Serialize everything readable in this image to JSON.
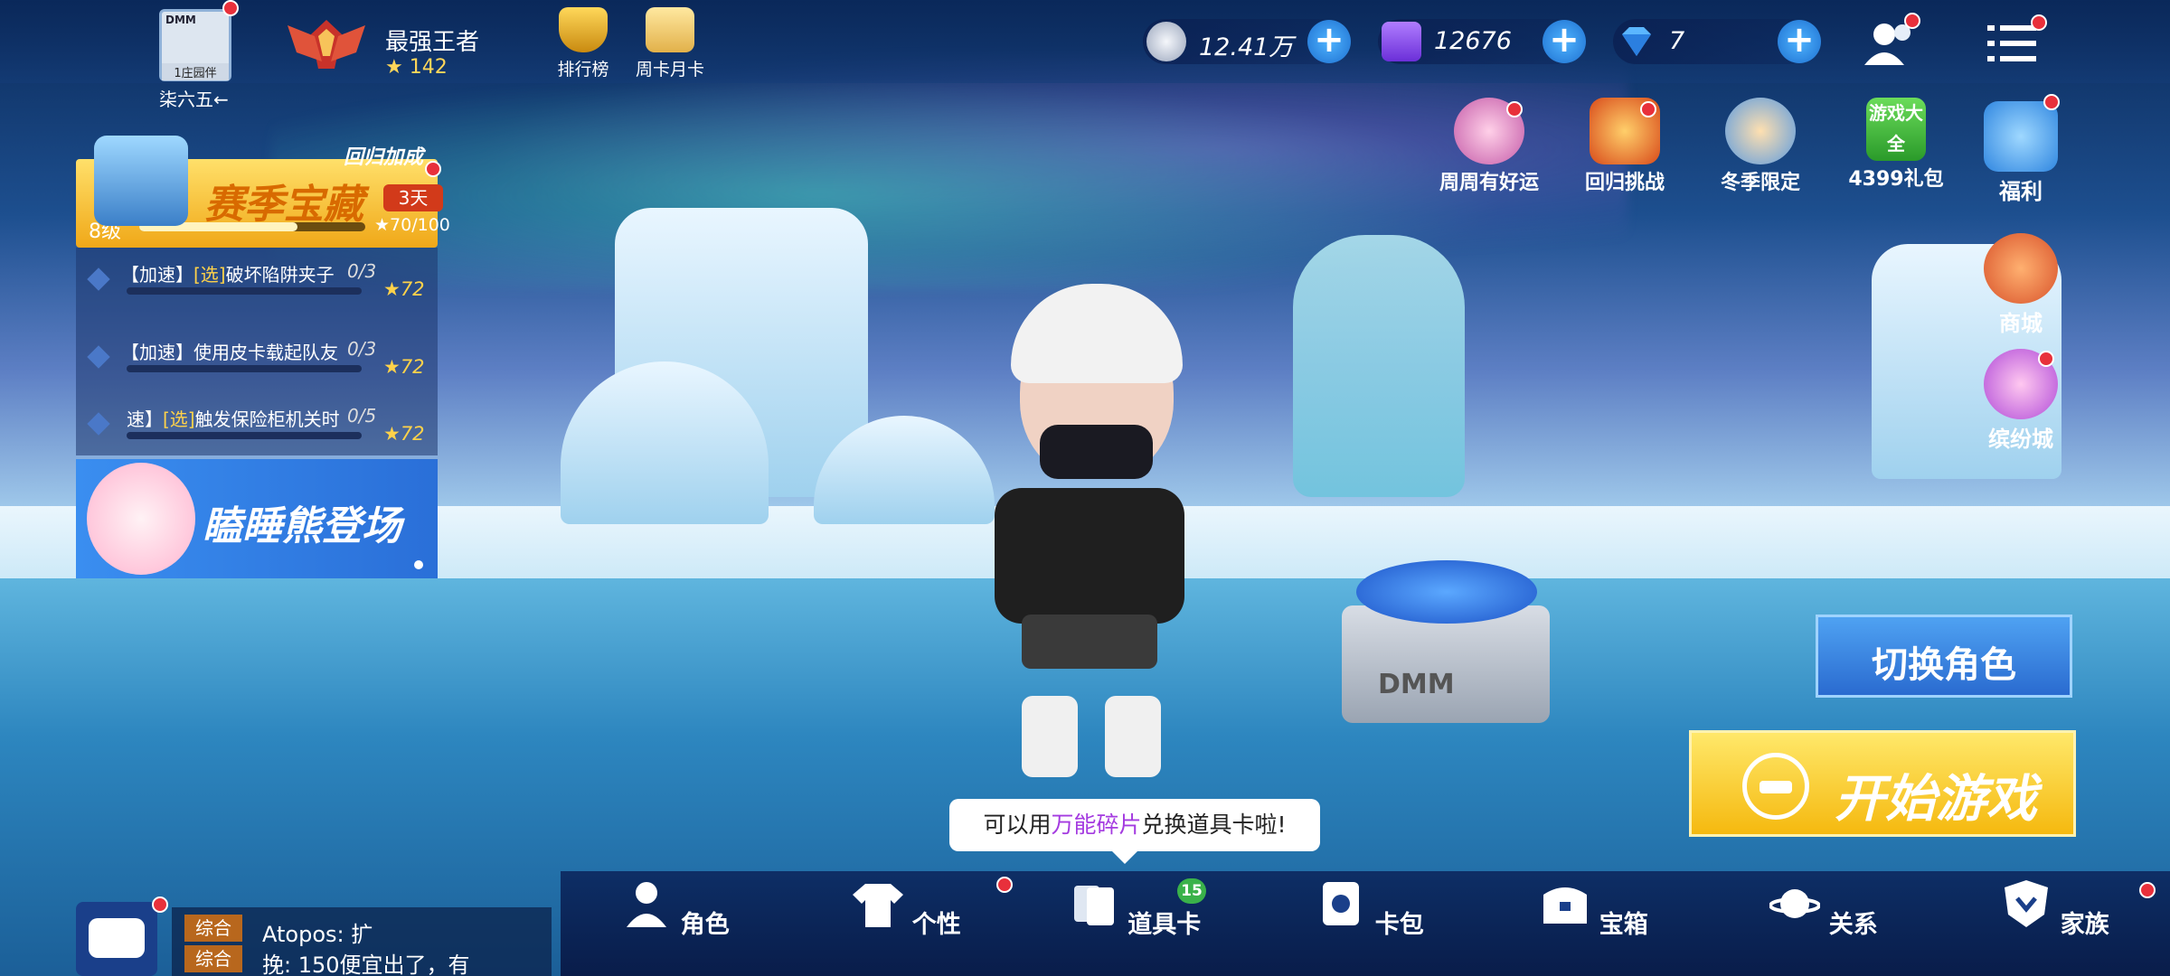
{
  "player": {
    "avatar_brand": "DMM",
    "avatar_tag": "1庄园伴",
    "name": "柒六五←",
    "rank_title": "最强王者",
    "rank_stars": "★ 142"
  },
  "top_icons": [
    {
      "label": "排行榜"
    },
    {
      "label": "周卡月卡"
    }
  ],
  "currencies": [
    {
      "icon": "silver-coin-icon",
      "value": "12.41万"
    },
    {
      "icon": "purple-e-coin-icon",
      "value": "12676"
    },
    {
      "icon": "diamond-icon",
      "value": "7"
    }
  ],
  "season": {
    "bonus_tag": "回归加成",
    "title": "赛季宝藏",
    "timer": "3天",
    "level": "8级",
    "progress_text": "★70/100",
    "progress": 0.7
  },
  "quests": [
    {
      "prefix": "【加速】",
      "opt": "[选]",
      "text": "破坏陷阱夹子",
      "count": "0/3",
      "reward": "★72"
    },
    {
      "prefix": "【加速】",
      "opt": "",
      "text": "使用皮卡载起队友",
      "count": "0/3",
      "reward": "★72"
    },
    {
      "prefix": "速】",
      "opt": "[选]",
      "text": "触发保险柜机关时",
      "count": "0/5",
      "reward": "★72"
    }
  ],
  "banner": {
    "text": "瞌睡熊登场"
  },
  "events": [
    {
      "label": "周周有好运"
    },
    {
      "label": "回归挑战"
    },
    {
      "label": "冬季限定"
    },
    {
      "label": "4399礼包",
      "icon_text": "游戏大全"
    },
    {
      "label": "福利"
    }
  ],
  "side_buttons": [
    {
      "label": "商城"
    },
    {
      "label": "缤纷城"
    }
  ],
  "actions": {
    "switch_role": "切换角色",
    "start_game": "开始游戏"
  },
  "tooltip": {
    "before": "可以用",
    "highlight": "万能碎片",
    "after": "兑换道具卡啦!"
  },
  "chest_brand": "DMM",
  "chat": {
    "channel1": "综合",
    "channel2": "综合",
    "line1": "Atopos: 扩",
    "line2": "挽: 150便宜出了，有"
  },
  "nav": [
    {
      "label": "角色",
      "icon": "person-icon"
    },
    {
      "label": "个性",
      "icon": "shirt-icon"
    },
    {
      "label": "道具卡",
      "icon": "cards-icon",
      "badge": "15"
    },
    {
      "label": "卡包",
      "icon": "card-pack-icon"
    },
    {
      "label": "宝箱",
      "icon": "chest-icon"
    },
    {
      "label": "关系",
      "icon": "planet-icon"
    },
    {
      "label": "家族",
      "icon": "shield-icon"
    }
  ],
  "colors": {
    "accent_blue": "#2a6bd0",
    "start_yellow": "#f5b90f",
    "alert_red": "#e8303b",
    "highlight_purple": "#a43be0"
  }
}
